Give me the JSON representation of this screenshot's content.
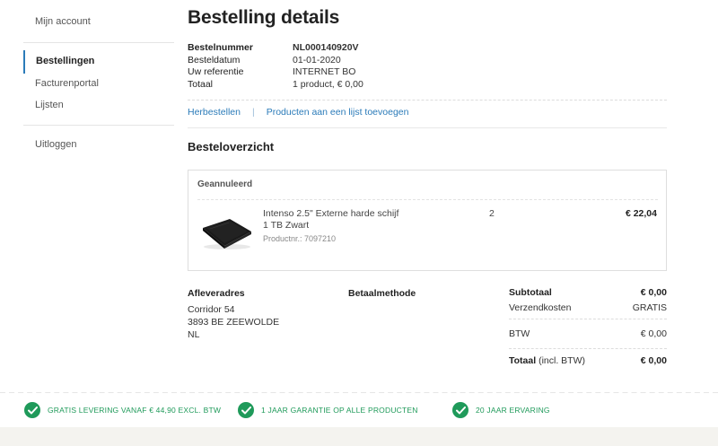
{
  "sidebar": {
    "account": "Mijn account",
    "orders": "Bestellingen",
    "invoices": "Facturenportal",
    "lists": "Lijsten",
    "logout": "Uitloggen"
  },
  "page": {
    "title": "Bestelling details"
  },
  "meta": [
    {
      "key": "Bestelnummer",
      "value": "NL000140920V"
    },
    {
      "key": "Besteldatum",
      "value": "01-01-2020"
    },
    {
      "key": "Uw referentie",
      "value": "INTERNET BO"
    },
    {
      "key": "Totaal",
      "value": "1 product, € 0,00"
    }
  ],
  "actions": {
    "reorder": "Herbestellen",
    "separator": "|",
    "add_to_list": "Producten aan een lijst toevoegen"
  },
  "overview": {
    "title": "Besteloverzicht",
    "status": "Geannuleerd",
    "product": {
      "name_line1": "Intenso 2.5\" Externe harde schijf",
      "name_line2": "1 TB Zwart",
      "number": "Productnr.: 7097210",
      "quantity": "2",
      "price": "€ 22,04"
    }
  },
  "delivery": {
    "title": "Afleveradres",
    "line1": "Corridor 54",
    "line2": "3893 BE ZEEWOLDE",
    "line3": "NL"
  },
  "payment": {
    "title": "Betaalmethode"
  },
  "totals": {
    "subtotal_label": "Subtotaal",
    "subtotal_value": "€ 0,00",
    "shipping_label": "Verzendkosten",
    "shipping_value": "GRATIS",
    "btw_label": "BTW",
    "btw_value": "€ 0,00",
    "total_label": "Totaal",
    "total_suffix": "(incl. BTW)",
    "total_value": "€ 0,00"
  },
  "usps": [
    "GRATIS LEVERING VANAF € 44,90 EXCL. BTW",
    "1 JAAR GARANTIE OP ALLE PRODUCTEN",
    "20 JAAR ERVARING"
  ],
  "colors": {
    "link": "#2b7bb9",
    "usp_green": "#1f9a5a",
    "icon_names": [
      "check-icon"
    ]
  }
}
